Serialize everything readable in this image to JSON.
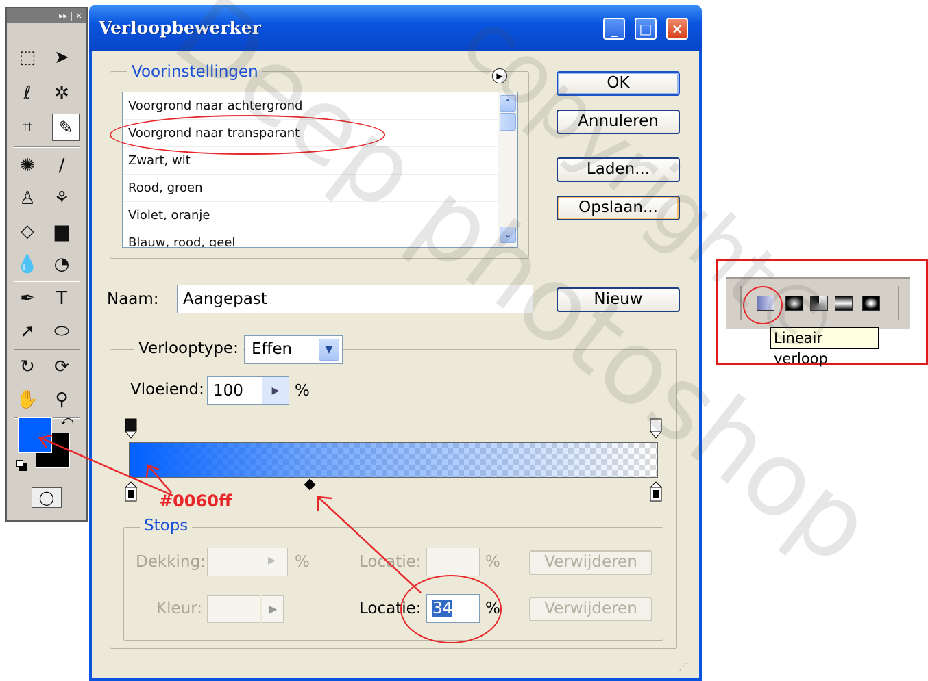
{
  "dialog": {
    "title": "Verloopbewerker",
    "buttons": {
      "minimize": "_",
      "maximize": "□",
      "close": "×",
      "ok": "OK",
      "cancel": "Annuleren",
      "load": "Laden...",
      "save": "Opslaan...",
      "new": "Nieuw"
    }
  },
  "presets": {
    "legend": "Voorinstellingen",
    "items": [
      "Voorgrond naar achtergrond",
      "Voorgrond naar transparant",
      "Zwart, wit",
      "Rood, groen",
      "Violet, oranje",
      "Blauw, rood, geel"
    ],
    "highlighted": "Voorgrond naar transparant"
  },
  "name": {
    "label": "Naam:",
    "value": "Aangepast"
  },
  "gradient_type": {
    "label": "Verlooptype:",
    "value": "Effen"
  },
  "smoothness": {
    "label": "Vloeiend:",
    "value": "100",
    "unit": "%"
  },
  "gradient_bar": {
    "start_color": "#0060ff",
    "midpoint_location_percent": 34
  },
  "stops": {
    "legend": "Stops",
    "opacity_label": "Dekking:",
    "opacity_value": "",
    "opacity_unit": "%",
    "location_label_top": "Locatie:",
    "location_value_top": "",
    "location_unit_top": "%",
    "delete_label_top": "Verwijderen",
    "color_label": "Kleur:",
    "location_label_bottom": "Locatie:",
    "location_value_bottom": "34",
    "location_unit_bottom": "%",
    "delete_label_bottom": "Verwijderen"
  },
  "annotations": {
    "color_hex": "#0060ff"
  },
  "toolbox": {
    "foreground_color": "#0060ff",
    "background_color": "#000000"
  },
  "gradient_toolbar": {
    "tooltip": "Lineair verloop",
    "types": [
      "linear-gradient-icon",
      "radial-gradient-icon",
      "angle-gradient-icon",
      "reflected-gradient-icon",
      "diamond-gradient-icon"
    ]
  },
  "watermark": {
    "text_1": "Deep photoshop",
    "text_2": "copyright©"
  }
}
